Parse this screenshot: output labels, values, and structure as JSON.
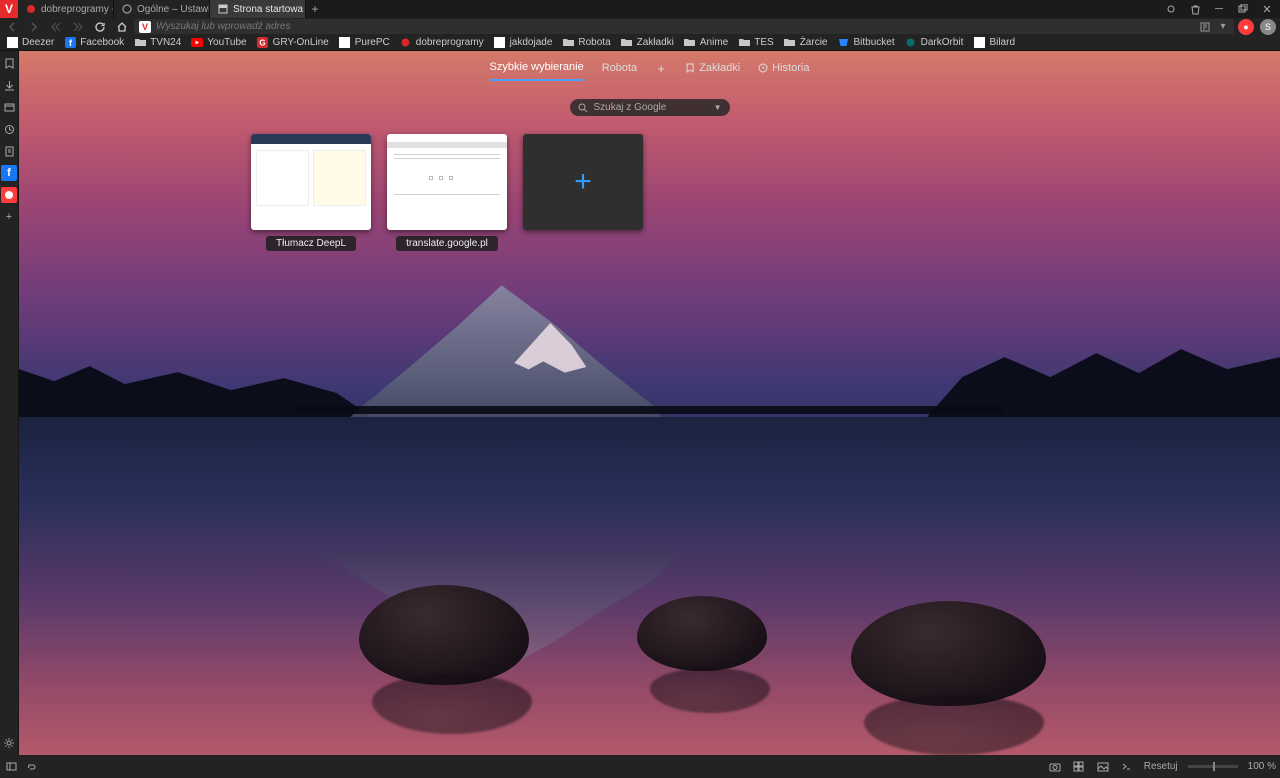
{
  "app_icon_letter": "V",
  "tabs": [
    {
      "title": "dobreprogramy - portal nie",
      "fav_color": "#d42a2a"
    },
    {
      "title": "Ogólne – Ustawienia",
      "fav_color": "#888888"
    },
    {
      "title": "Strona startowa",
      "fav_color": "#cccccc",
      "active": true
    }
  ],
  "address_bar": {
    "placeholder": "Wyszukaj lub wprowadź adres",
    "prefix_letter": "V"
  },
  "bookmarks": [
    {
      "label": "Deezer",
      "icon": "generic"
    },
    {
      "label": "Facebook",
      "icon": "fb"
    },
    {
      "label": "TVN24",
      "icon": "folder"
    },
    {
      "label": "YouTube",
      "icon": "yt"
    },
    {
      "label": "GRY-OnLine",
      "icon": "gry"
    },
    {
      "label": "PurePC",
      "icon": "generic"
    },
    {
      "label": "dobreprogramy",
      "icon": "dp"
    },
    {
      "label": "jakdojade",
      "icon": "generic"
    },
    {
      "label": "Robota",
      "icon": "folder"
    },
    {
      "label": "Zakładki",
      "icon": "folder"
    },
    {
      "label": "Anime",
      "icon": "folder"
    },
    {
      "label": "TES",
      "icon": "folder"
    },
    {
      "label": "Żarcie",
      "icon": "folder"
    },
    {
      "label": "Bitbucket",
      "icon": "generic"
    },
    {
      "label": "DarkOrbit",
      "icon": "do"
    },
    {
      "label": "Bilard",
      "icon": "generic"
    }
  ],
  "start_page": {
    "nav": {
      "speed_dial": "Szybkie wybieranie",
      "group1": "Robota",
      "bookmarks": "Zakładki",
      "history": "Historia"
    },
    "search_placeholder": "Szukaj z Google",
    "tiles": [
      {
        "label": "Tłumacz DeepL",
        "variant": "deepl"
      },
      {
        "label": "translate.google.pl",
        "variant": "gtranslate"
      }
    ]
  },
  "status": {
    "reset": "Resetuj",
    "zoom": "100 %"
  }
}
